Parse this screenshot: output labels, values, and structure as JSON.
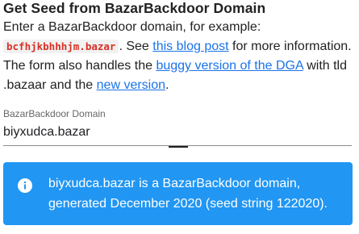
{
  "title": "Get Seed from BazarBackdoor Domain",
  "intro": {
    "prefix": "Enter a BazarBackdoor domain, for example: ",
    "example_domain": "bcfhjkbhhhjm.bazar",
    "see": ". See ",
    "blog_link": "this blog post",
    "more_info": " for more information. The form also handles the ",
    "buggy_link": "buggy version of the DGA",
    "tld_text": " with tld .bazaar and the ",
    "new_link": "new version",
    "end": "."
  },
  "field": {
    "label": "BazarBackdoor Domain",
    "value": "biyxudca.bazar"
  },
  "alert": {
    "icon": "info-icon",
    "color": "#2196f3",
    "text": "biyxudca.bazar is a BazarBackdoor domain, generated December 2020 (seed string 122020)."
  },
  "colors": {
    "link": "#1a73e8",
    "code": "#d93025"
  }
}
